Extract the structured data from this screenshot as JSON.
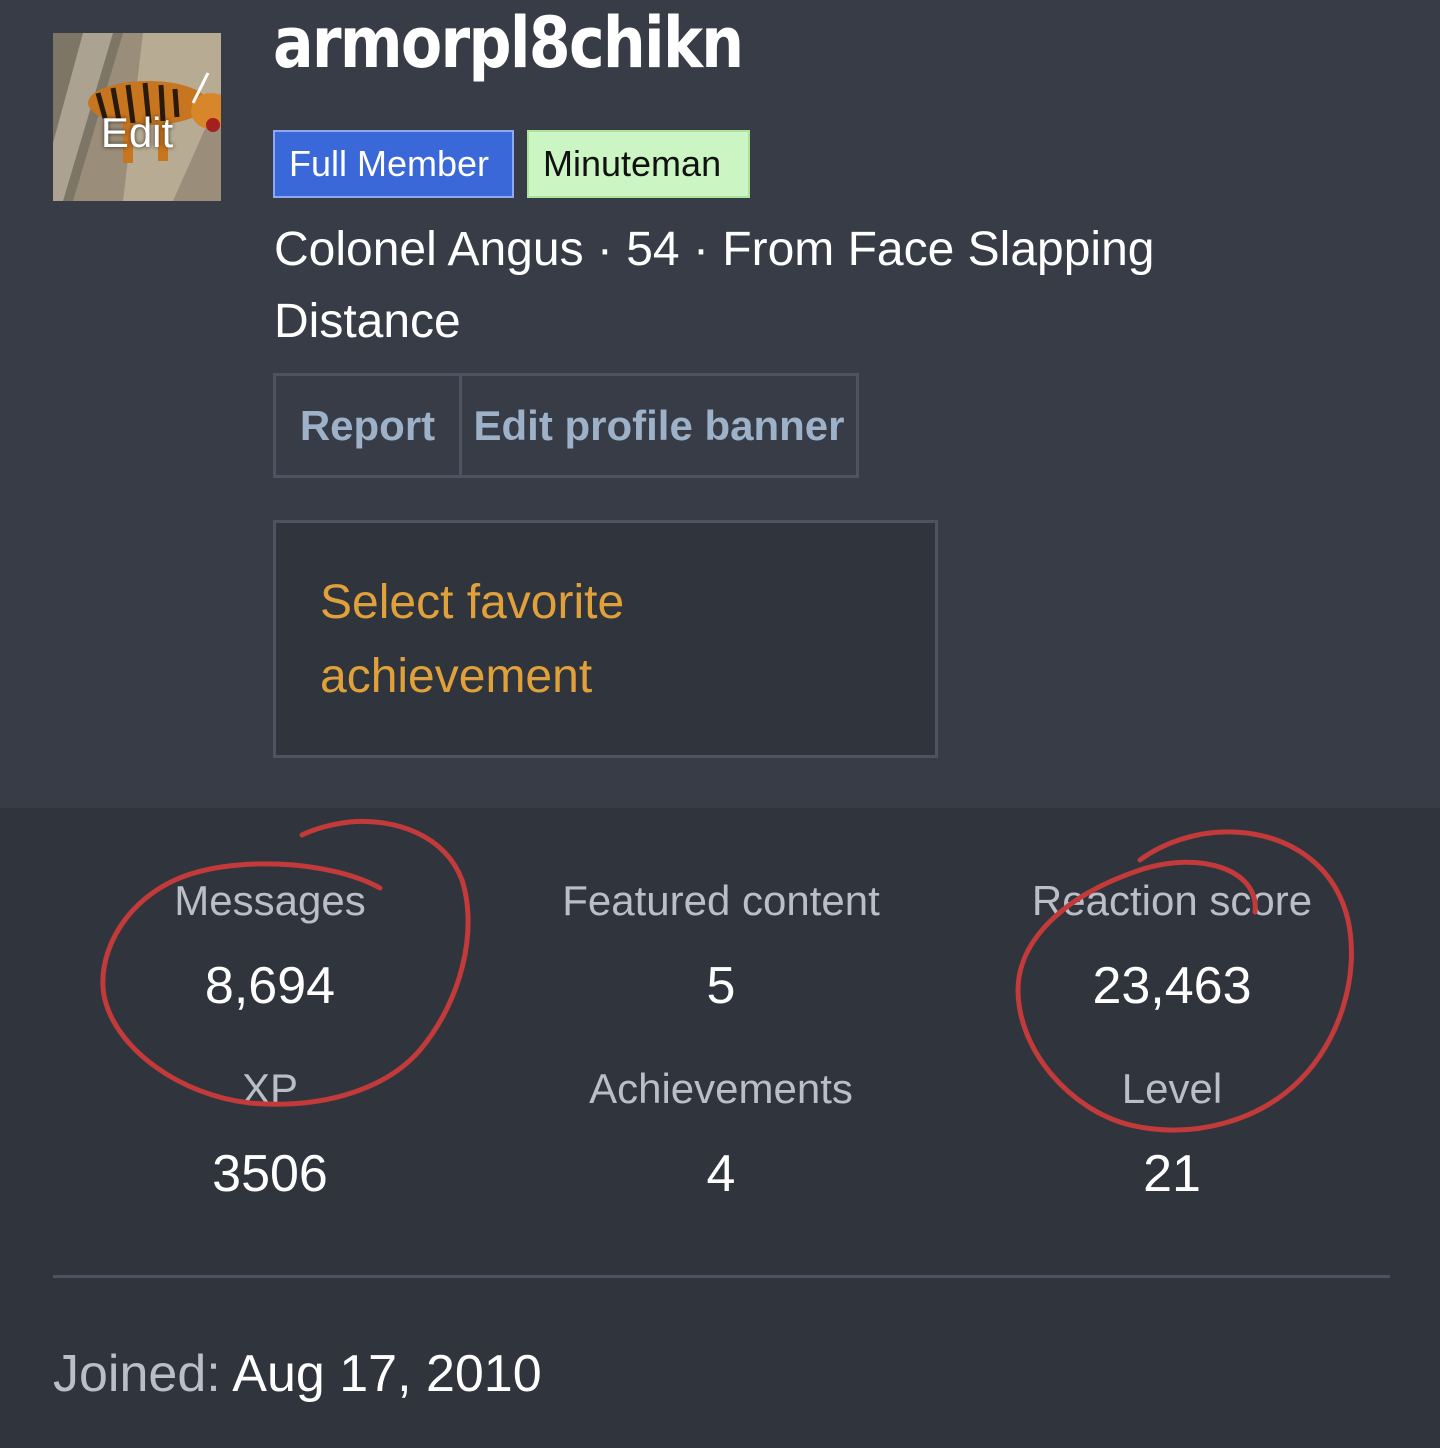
{
  "avatar": {
    "edit_label": "Edit"
  },
  "profile": {
    "username": "armorpl8chikn",
    "badges": [
      "Full Member",
      "Minuteman"
    ],
    "blurb": "Colonel Angus · 54 · From Face Slapping Distance"
  },
  "actions": {
    "report_label": "Report",
    "edit_banner_label": "Edit profile banner"
  },
  "favorite": {
    "select_label": "Select favorite achievement"
  },
  "stats": [
    {
      "label": "Messages",
      "value": "8,694"
    },
    {
      "label": "Featured content",
      "value": "5"
    },
    {
      "label": "Reaction score",
      "value": "23,463"
    },
    {
      "label": "XP",
      "value": "3506"
    },
    {
      "label": "Achievements",
      "value": "4"
    },
    {
      "label": "Level",
      "value": "21"
    }
  ],
  "joined": {
    "label": "Joined:",
    "value": "Aug 17, 2010"
  },
  "colors": {
    "background": "#373c46",
    "stats_background": "#30343d",
    "full_member_badge": "#3b68d8",
    "minuteman_badge": "#ccf5c4",
    "favorite_link": "#e0a13a",
    "annotation_circle": "#c23a3a"
  }
}
